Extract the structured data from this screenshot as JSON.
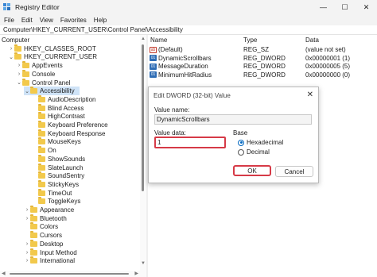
{
  "window": {
    "title": "Registry Editor",
    "controls": {
      "minimize": "—",
      "maximize": "☐",
      "close": "✕"
    }
  },
  "menu": [
    "File",
    "Edit",
    "View",
    "Favorites",
    "Help"
  ],
  "address": "Computer\\HKEY_CURRENT_USER\\Control Panel\\Accessibility",
  "tree": [
    {
      "label": "Computer",
      "expand": "",
      "folder": false,
      "selected": false
    },
    {
      "label": "HKEY_CLASSES_ROOT",
      "expand": ">",
      "folder": true,
      "selected": false
    },
    {
      "label": "HKEY_CURRENT_USER",
      "expand": "v",
      "folder": true,
      "selected": false
    },
    {
      "label": "AppEvents",
      "expand": ">",
      "folder": true,
      "selected": false
    },
    {
      "label": "Console",
      "expand": ">",
      "folder": true,
      "selected": false
    },
    {
      "label": "Control Panel",
      "expand": "v",
      "folder": true,
      "selected": false
    },
    {
      "label": "Accessibility",
      "expand": "v",
      "folder": true,
      "selected": true
    },
    {
      "label": "AudioDescription",
      "expand": "",
      "folder": true,
      "selected": false
    },
    {
      "label": "Blind Access",
      "expand": "",
      "folder": true,
      "selected": false
    },
    {
      "label": "HighContrast",
      "expand": "",
      "folder": true,
      "selected": false
    },
    {
      "label": "Keyboard Preference",
      "expand": "",
      "folder": true,
      "selected": false
    },
    {
      "label": "Keyboard Response",
      "expand": "",
      "folder": true,
      "selected": false
    },
    {
      "label": "MouseKeys",
      "expand": "",
      "folder": true,
      "selected": false
    },
    {
      "label": "On",
      "expand": "",
      "folder": true,
      "selected": false
    },
    {
      "label": "ShowSounds",
      "expand": "",
      "folder": true,
      "selected": false
    },
    {
      "label": "SlateLaunch",
      "expand": "",
      "folder": true,
      "selected": false
    },
    {
      "label": "SoundSentry",
      "expand": "",
      "folder": true,
      "selected": false
    },
    {
      "label": "StickyKeys",
      "expand": "",
      "folder": true,
      "selected": false
    },
    {
      "label": "TimeOut",
      "expand": "",
      "folder": true,
      "selected": false
    },
    {
      "label": "ToggleKeys",
      "expand": "",
      "folder": true,
      "selected": false
    },
    {
      "label": "Appearance",
      "expand": ">",
      "folder": true,
      "selected": false
    },
    {
      "label": "Bluetooth",
      "expand": ">",
      "folder": true,
      "selected": false
    },
    {
      "label": "Colors",
      "expand": "",
      "folder": true,
      "selected": false
    },
    {
      "label": "Cursors",
      "expand": "",
      "folder": true,
      "selected": false
    },
    {
      "label": "Desktop",
      "expand": ">",
      "folder": true,
      "selected": false
    },
    {
      "label": "Input Method",
      "expand": ">",
      "folder": true,
      "selected": false
    },
    {
      "label": "International",
      "expand": ">",
      "folder": true,
      "selected": false
    }
  ],
  "values_table": {
    "headers": {
      "name": "Name",
      "type": "Type",
      "data": "Data"
    },
    "rows": [
      {
        "icon": "string-value-icon",
        "badge": "ab",
        "name": "(Default)",
        "type": "REG_SZ",
        "data": "(value not set)"
      },
      {
        "icon": "dword-value-icon",
        "badge": "01",
        "name": "DynamicScrollbars",
        "type": "REG_DWORD",
        "data": "0x00000001 (1)"
      },
      {
        "icon": "dword-value-icon",
        "badge": "01",
        "name": "MessageDuration",
        "type": "REG_DWORD",
        "data": "0x00000005 (5)"
      },
      {
        "icon": "dword-value-icon",
        "badge": "01",
        "name": "MinimumHitRadius",
        "type": "REG_DWORD",
        "data": "0x00000000 (0)"
      }
    ]
  },
  "dialog": {
    "title": "Edit DWORD (32-bit) Value",
    "close": "✕",
    "value_name_label": "Value name:",
    "value_name": "DynamicScrollbars",
    "value_data_label": "Value data:",
    "value_data": "1",
    "base_label": "Base",
    "hex_label": "Hexadecimal",
    "dec_label": "Decimal",
    "ok_label": "OK",
    "cancel_label": "Cancel"
  },
  "scroll_arrows": {
    "up": "▲",
    "down": "▼",
    "left": "◀",
    "right": "▶"
  },
  "colors": {
    "highlight": "#d63a47",
    "selected_row": "#cfe3f7",
    "folder": "#f2c94c",
    "accent": "#0067c0"
  }
}
